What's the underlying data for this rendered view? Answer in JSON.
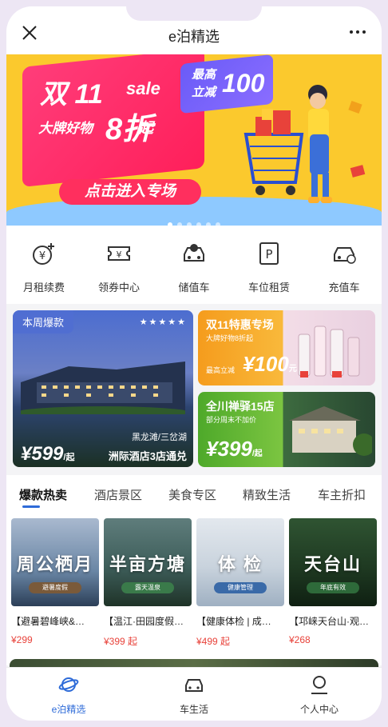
{
  "header": {
    "title": "e泊精选"
  },
  "banner": {
    "line1": "双 11",
    "line1_suffix": "sale",
    "line2": "大牌好物",
    "line3": "8折",
    "line3_suffix": "起",
    "promo_a": "最高",
    "promo_b": "立减",
    "promo_num": "100",
    "cta": "点击进入专场",
    "dots_total": 6,
    "dots_active": 1
  },
  "quick_menu": [
    {
      "label": "月租续费",
      "icon": "monthly-rent-icon"
    },
    {
      "label": "领券中心",
      "icon": "coupon-icon"
    },
    {
      "label": "储值车",
      "icon": "stored-value-car-icon"
    },
    {
      "label": "车位租赁",
      "icon": "parking-lease-icon"
    },
    {
      "label": "充值车",
      "icon": "recharge-car-icon"
    }
  ],
  "promo": {
    "big": {
      "tag": "本周爆款",
      "stars": "★★★★★",
      "location": "黑龙滩/三岔湖",
      "price": "¥599",
      "price_unit": "/起",
      "name": "洲际酒店3店通兑"
    },
    "card1": {
      "title": "双11特惠专场",
      "subtitle": "大牌好物8折起",
      "prefix": "最高立减",
      "price": "¥100",
      "price_unit": "元"
    },
    "card2": {
      "title": "全川禅驿15店",
      "subtitle": "部分周末不加价",
      "price": "¥399",
      "price_unit": "/起"
    }
  },
  "tabs": [
    {
      "label": "爆款热卖",
      "active": true
    },
    {
      "label": "酒店景区"
    },
    {
      "label": "美食专区"
    },
    {
      "label": "精致生活"
    },
    {
      "label": "车主折扣"
    }
  ],
  "products": [
    {
      "big": "周公栖月",
      "pill": "避暑度假",
      "title": "【避暑碧峰峡&…",
      "price": "¥299",
      "bg": "#7c93b0",
      "pill_color": "#7a5a3a"
    },
    {
      "big": "半亩方塘",
      "pill": "露天温泉",
      "title": "【温江·田园度假…",
      "price": "¥399 起",
      "bg": "#3e5e5a",
      "pill_color": "#3a7a4a"
    },
    {
      "big": "体 检",
      "pill": "健康管理",
      "title": "【健康体检 | 成…",
      "price": "¥499 起",
      "bg": "#c9d3dd",
      "pill_color": "#3a6aa8"
    },
    {
      "big": "天台山",
      "pill": "年底有效",
      "title": "【邛崃天台山·观…",
      "price": "¥268",
      "bg": "#1f3a22",
      "pill_color": "#2e6a3a"
    }
  ],
  "bottom_nav": [
    {
      "label": "e泊精选",
      "icon": "planet-icon",
      "active": true
    },
    {
      "label": "车生活",
      "icon": "car-icon"
    },
    {
      "label": "个人中心",
      "icon": "user-icon"
    }
  ],
  "colors": {
    "accent": "#2e6bd8",
    "price": "#e8423a",
    "banner_yellow": "#fbc92d",
    "banner_pink": "#ff2f5e"
  }
}
